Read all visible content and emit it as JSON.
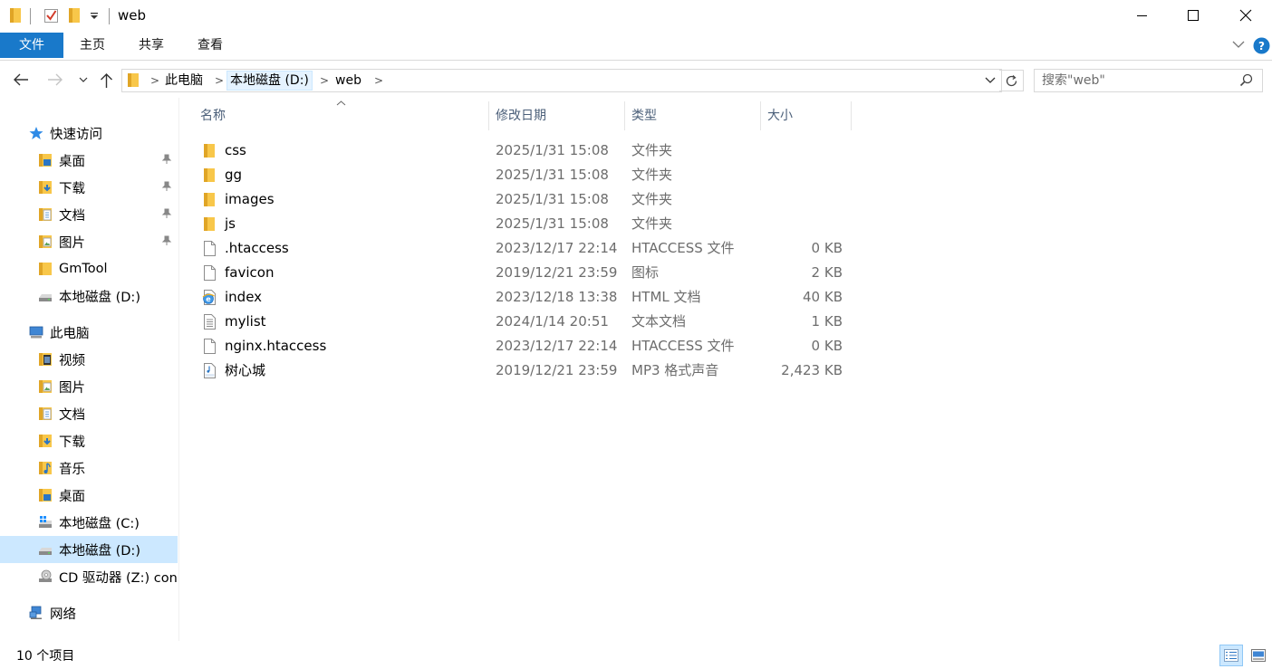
{
  "window": {
    "title": "web",
    "minimize_glyph": "—",
    "restore_glyph": "☐",
    "close_glyph": "✕"
  },
  "ribbon": {
    "tabs": [
      "文件",
      "主页",
      "共享",
      "查看"
    ]
  },
  "nav": {
    "breadcrumbs": [
      "此电脑",
      "本地磁盘 (D:)",
      "web"
    ]
  },
  "search": {
    "placeholder": "搜索\"web\""
  },
  "sidebar": {
    "items": [
      {
        "label": "快速访问",
        "icon": "star-icon"
      },
      {
        "label": "桌面",
        "icon": "desktop-folder-icon"
      },
      {
        "label": "下载",
        "icon": "download-folder-icon"
      },
      {
        "label": "文档",
        "icon": "documents-folder-icon"
      },
      {
        "label": "图片",
        "icon": "pictures-folder-icon"
      },
      {
        "label": "GmTool",
        "icon": "folder-icon"
      },
      {
        "label": "本地磁盘 (D:)",
        "icon": "drive-icon"
      },
      {
        "label": "此电脑",
        "icon": "computer-icon"
      },
      {
        "label": "视频",
        "icon": "videos-folder-icon"
      },
      {
        "label": "图片",
        "icon": "pictures-folder-icon"
      },
      {
        "label": "文档",
        "icon": "documents-folder-icon"
      },
      {
        "label": "下载",
        "icon": "download-folder-icon"
      },
      {
        "label": "音乐",
        "icon": "music-folder-icon"
      },
      {
        "label": "桌面",
        "icon": "desktop-folder-icon"
      },
      {
        "label": "本地磁盘 (C:)",
        "icon": "windows-drive-icon"
      },
      {
        "label": "本地磁盘 (D:)",
        "icon": "drive-icon"
      },
      {
        "label": "CD 驱动器 (Z:) con",
        "icon": "cd-drive-icon"
      },
      {
        "label": "网络",
        "icon": "network-icon"
      }
    ]
  },
  "columns": {
    "name": "名称",
    "date": "修改日期",
    "type": "类型",
    "size": "大小"
  },
  "files": [
    {
      "name": "css",
      "date": "2025/1/31 15:08",
      "type": "文件夹",
      "size": "",
      "icon": "folder-icon"
    },
    {
      "name": "gg",
      "date": "2025/1/31 15:08",
      "type": "文件夹",
      "size": "",
      "icon": "folder-icon"
    },
    {
      "name": "images",
      "date": "2025/1/31 15:08",
      "type": "文件夹",
      "size": "",
      "icon": "folder-icon"
    },
    {
      "name": "js",
      "date": "2025/1/31 15:08",
      "type": "文件夹",
      "size": "",
      "icon": "folder-icon"
    },
    {
      "name": ".htaccess",
      "date": "2023/12/17 22:14",
      "type": "HTACCESS 文件",
      "size": "0 KB",
      "icon": "file-icon"
    },
    {
      "name": "favicon",
      "date": "2019/12/21 23:59",
      "type": "图标",
      "size": "2 KB",
      "icon": "file-icon"
    },
    {
      "name": "index",
      "date": "2023/12/18 13:38",
      "type": "HTML 文档",
      "size": "40 KB",
      "icon": "html-file-icon"
    },
    {
      "name": "mylist",
      "date": "2024/1/14 20:51",
      "type": "文本文档",
      "size": "1 KB",
      "icon": "text-file-icon"
    },
    {
      "name": "nginx.htaccess",
      "date": "2023/12/17 22:14",
      "type": "HTACCESS 文件",
      "size": "0 KB",
      "icon": "file-icon"
    },
    {
      "name": "树心城",
      "date": "2019/12/21 23:59",
      "type": "MP3 格式声音",
      "size": "2,423 KB",
      "icon": "mp3-file-icon"
    }
  ],
  "status": {
    "item_count": "10 个项目"
  },
  "colors": {
    "accent": "#1979ca",
    "selected": "#cce8ff",
    "folder": "#f8c74a",
    "header_text": "#4c607a",
    "meta_text": "#6d6d6d"
  }
}
